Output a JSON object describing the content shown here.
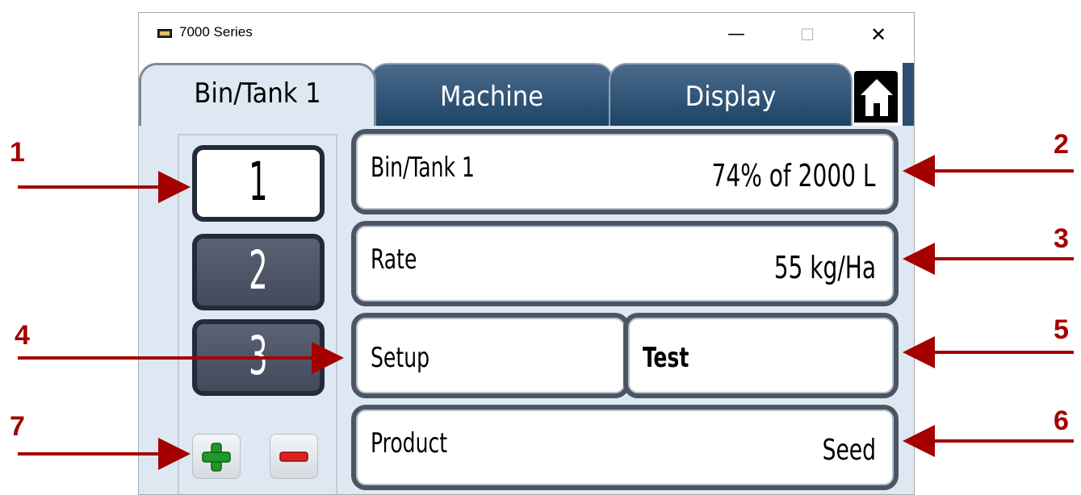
{
  "window": {
    "title": "7000 Series",
    "controls": {
      "minimize": "—",
      "maximize": "☐",
      "close": "✕"
    }
  },
  "tabs": [
    {
      "label": "Bin/Tank 1",
      "active": true
    },
    {
      "label": "Machine",
      "active": false
    },
    {
      "label": "Display",
      "active": false
    }
  ],
  "home_icon": "home-icon",
  "bins": [
    {
      "label": "1",
      "selected": true
    },
    {
      "label": "2",
      "selected": false
    },
    {
      "label": "3",
      "selected": false
    }
  ],
  "bin_tank": {
    "label": "Bin/Tank 1",
    "value": "74% of 2000 L"
  },
  "rate": {
    "label": "Rate",
    "value": "55 kg/Ha"
  },
  "setup": {
    "label": "Setup"
  },
  "test": {
    "label": "Test"
  },
  "product": {
    "label": "Product",
    "value": "Seed"
  },
  "annotations": [
    "1",
    "2",
    "3",
    "4",
    "5",
    "6",
    "7"
  ],
  "colors": {
    "annotation": "#a50000",
    "tab_inactive": "#2c4f72",
    "panel": "#dde8f2",
    "button_dark": "#434a5c"
  }
}
